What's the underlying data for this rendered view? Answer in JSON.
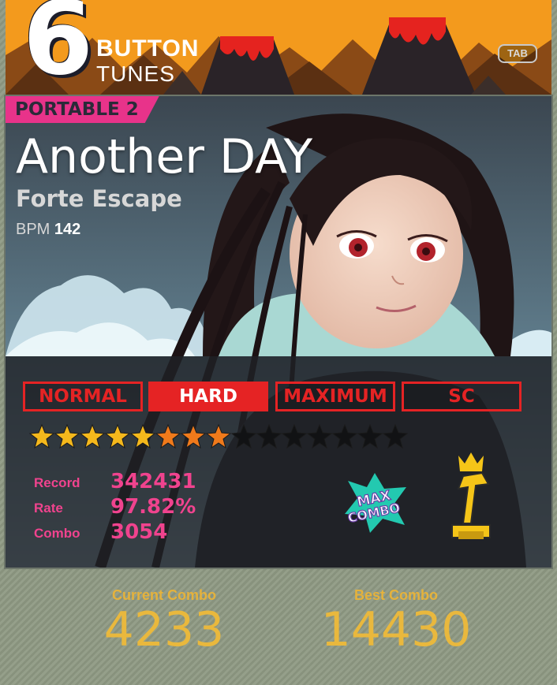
{
  "header": {
    "logo_number": "6",
    "logo_word1": "BUTTON",
    "logo_word2": "TUNES",
    "tab_label": "TAB"
  },
  "song": {
    "series_tag": "PORTABLE 2",
    "title": "Another DAY",
    "artist": "Forte Escape",
    "bpm_label": "BPM",
    "bpm_value": "142"
  },
  "difficulties": [
    {
      "label": "NORMAL",
      "selected": false
    },
    {
      "label": "HARD",
      "selected": true
    },
    {
      "label": "MAXIMUM",
      "selected": false
    },
    {
      "label": "SC",
      "selected": false
    }
  ],
  "stars": {
    "total": 15,
    "yellow": 5,
    "orange": 3
  },
  "stats": {
    "record_label": "Record",
    "record_value": "342431",
    "rate_label": "Rate",
    "rate_value": "97.82%",
    "combo_label": "Combo",
    "combo_value": "3054"
  },
  "badge": {
    "line1": "MAX",
    "line2": "COMBO"
  },
  "bottom": {
    "current_label": "Current Combo",
    "current_value": "4233",
    "best_label": "Best Combo",
    "best_value": "14430"
  },
  "colors": {
    "header_orange": "#f39a1d",
    "difficulty_red": "#e52324",
    "stat_pink": "#f0438e",
    "combo_gold": "#e9b83d",
    "star_yellow": "#f4b81c",
    "star_orange": "#f07a1b"
  }
}
